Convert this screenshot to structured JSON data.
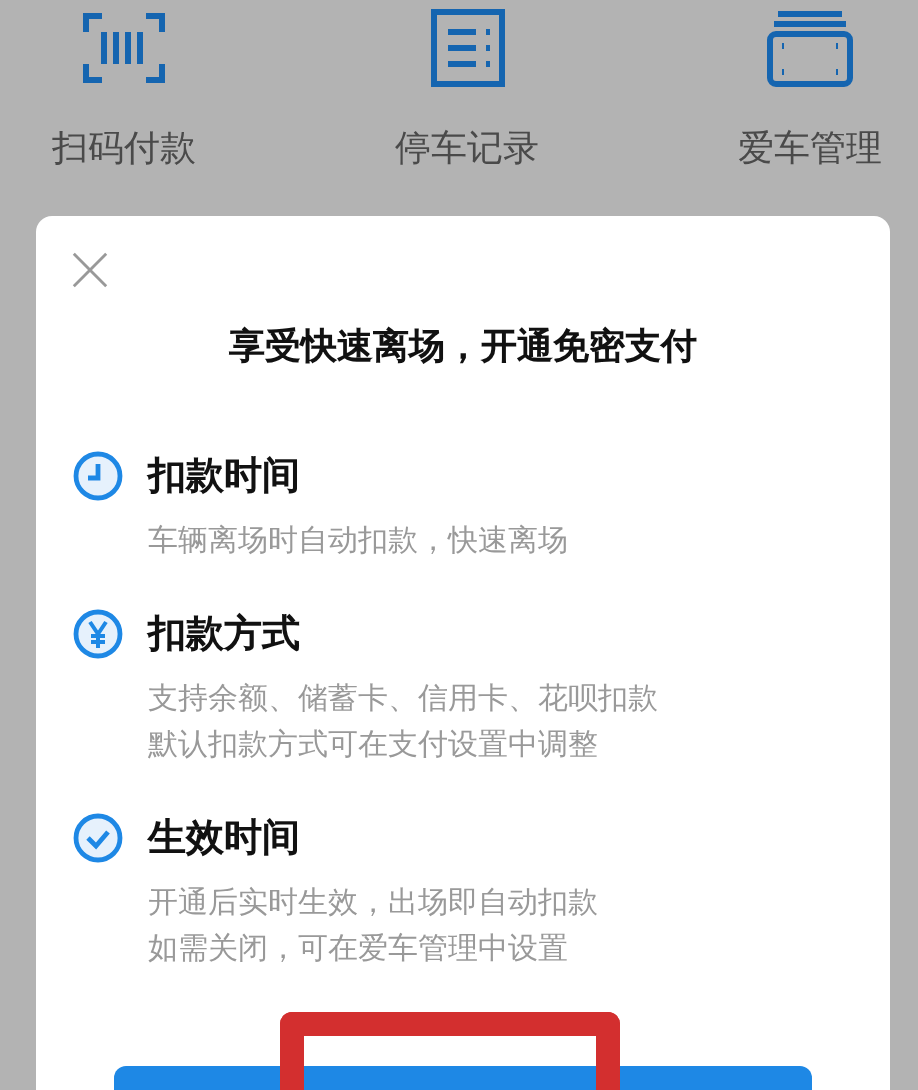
{
  "shortcuts": [
    {
      "kind": "scan",
      "label": "扫码付款"
    },
    {
      "kind": "records",
      "label": "停车记录"
    },
    {
      "kind": "car",
      "label": "爱车管理"
    }
  ],
  "dialog": {
    "title": "享受快速离场，开通免密支付",
    "sections": [
      {
        "kind": "clock",
        "heading": "扣款时间",
        "lines": [
          "车辆离场时自动扣款，快速离场"
        ]
      },
      {
        "kind": "yen",
        "heading": "扣款方式",
        "lines": [
          "支持余额、储蓄卡、信用卡、花呗扣款",
          "默认扣款方式可在支付设置中调整"
        ]
      },
      {
        "kind": "check",
        "heading": "生效时间",
        "lines": [
          "开通后实时生效，出场即自动扣款",
          "如需关闭，可在爱车管理中设置"
        ]
      }
    ]
  }
}
